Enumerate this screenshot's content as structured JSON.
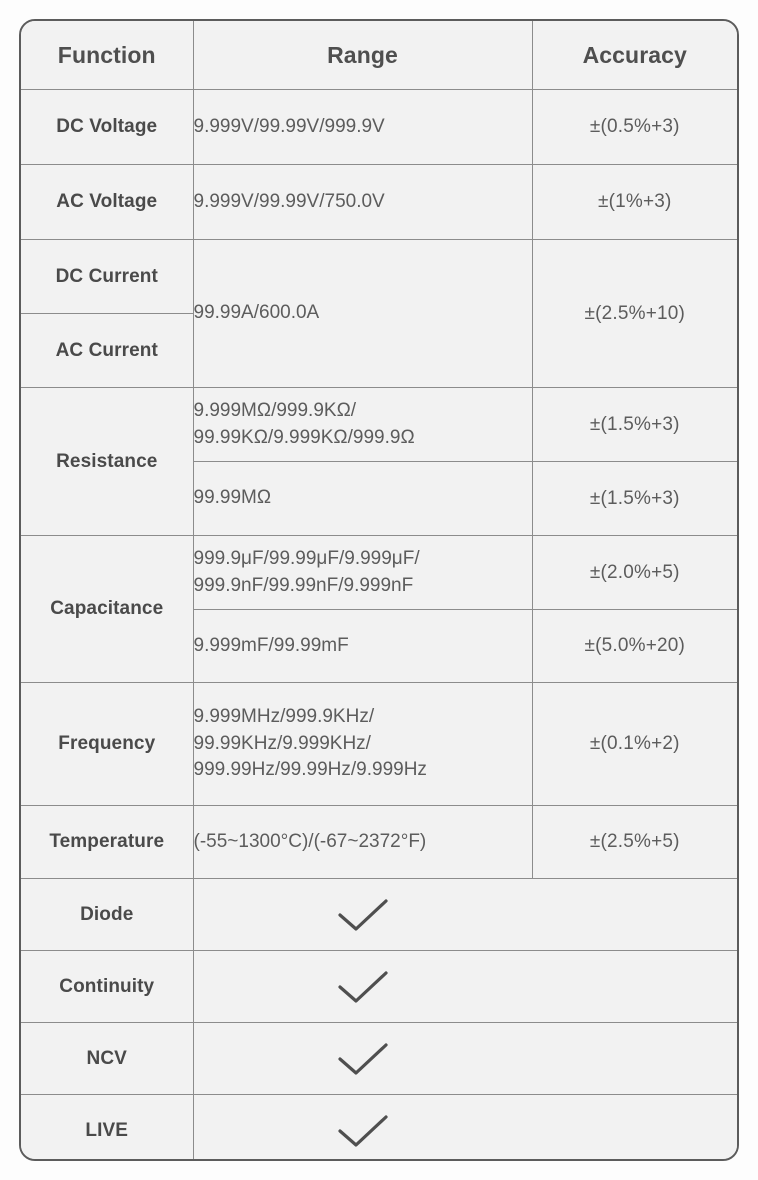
{
  "table": {
    "headers": {
      "function": "Function",
      "range": "Range",
      "accuracy": "Accuracy"
    },
    "rows": [
      {
        "function": "DC Voltage",
        "range": "9.999V/99.99V/999.9V",
        "accuracy": "±(0.5%+3)"
      },
      {
        "function": "AC Voltage",
        "range": "9.999V/99.99V/750.0V",
        "accuracy": "±(1%+3)"
      },
      {
        "function": "DC Current",
        "range": "99.99A/600.0A",
        "accuracy": "±(2.5%+10)"
      },
      {
        "function": "AC Current",
        "range": "99.99A/600.0A",
        "accuracy": "±(2.5%+10)"
      },
      {
        "function": "Resistance",
        "range": "9.999MΩ/999.9KΩ/\n99.99KΩ/9.999KΩ/999.9Ω",
        "accuracy": "±(1.5%+3)"
      },
      {
        "function": "Resistance",
        "range": "99.99MΩ",
        "accuracy": "±(1.5%+3)"
      },
      {
        "function": "Capacitance",
        "range": "999.9μF/99.99μF/9.999μF/\n999.9nF/99.99nF/9.999nF",
        "accuracy": "±(2.0%+5)"
      },
      {
        "function": "Capacitance",
        "range": "9.999mF/99.99mF",
        "accuracy": "±(5.0%+20)"
      },
      {
        "function": "Frequency",
        "range": "9.999MHz/999.9KHz/\n99.99KHz/9.999KHz/\n999.99Hz/99.99Hz/9.999Hz",
        "accuracy": "±(0.1%+2)"
      },
      {
        "function": "Temperature",
        "range": "(-55~1300°C)/(-67~2372°F)",
        "accuracy": "±(2.5%+5)"
      },
      {
        "function": "Diode",
        "range": "check-icon",
        "accuracy": ""
      },
      {
        "function": "Continuity",
        "range": "check-icon",
        "accuracy": ""
      },
      {
        "function": "NCV",
        "range": "check-icon",
        "accuracy": ""
      },
      {
        "function": "LIVE",
        "range": "check-icon",
        "accuracy": ""
      }
    ],
    "labels": {
      "dc_voltage": "DC Voltage",
      "ac_voltage": "AC Voltage",
      "dc_current": "DC Current",
      "ac_current": "AC Current",
      "resistance": "Resistance",
      "capacitance": "Capacitance",
      "frequency": "Frequency",
      "temperature": "Temperature",
      "diode": "Diode",
      "continuity": "Continuity",
      "ncv": "NCV",
      "live": "LIVE"
    },
    "ranges": {
      "dc_voltage": "9.999V/99.99V/999.9V",
      "ac_voltage": "9.999V/99.99V/750.0V",
      "current": "99.99A/600.0A",
      "resistance_1": "9.999MΩ/999.9KΩ/\n99.99KΩ/9.999KΩ/999.9Ω",
      "resistance_2": "99.99MΩ",
      "capacitance_1": "999.9μF/99.99μF/9.999μF/\n999.9nF/99.99nF/9.999nF",
      "capacitance_2": "9.999mF/99.99mF",
      "frequency": "9.999MHz/999.9KHz/\n99.99KHz/9.999KHz/\n999.99Hz/99.99Hz/9.999Hz",
      "temperature": "(-55~1300°C)/(-67~2372°F)"
    },
    "accuracies": {
      "dc_voltage": "±(0.5%+3)",
      "ac_voltage": "±(1%+3)",
      "current": "±(2.5%+10)",
      "resistance_1": "±(1.5%+3)",
      "resistance_2": "±(1.5%+3)",
      "capacitance_1": "±(2.0%+5)",
      "capacitance_2": "±(5.0%+20)",
      "frequency": "±(0.1%+2)",
      "temperature": "±(2.5%+5)"
    },
    "colors": {
      "table_background": "#f2f2f2",
      "page_background": "#fdfdfd",
      "outer_border": "#5c5c5c",
      "inner_border": "#8c8c8c",
      "header_text": "#4f4f4f",
      "function_text": "#4a4a4a",
      "value_text": "#5c5c5c",
      "check_stroke": "#4f4f4f"
    }
  }
}
